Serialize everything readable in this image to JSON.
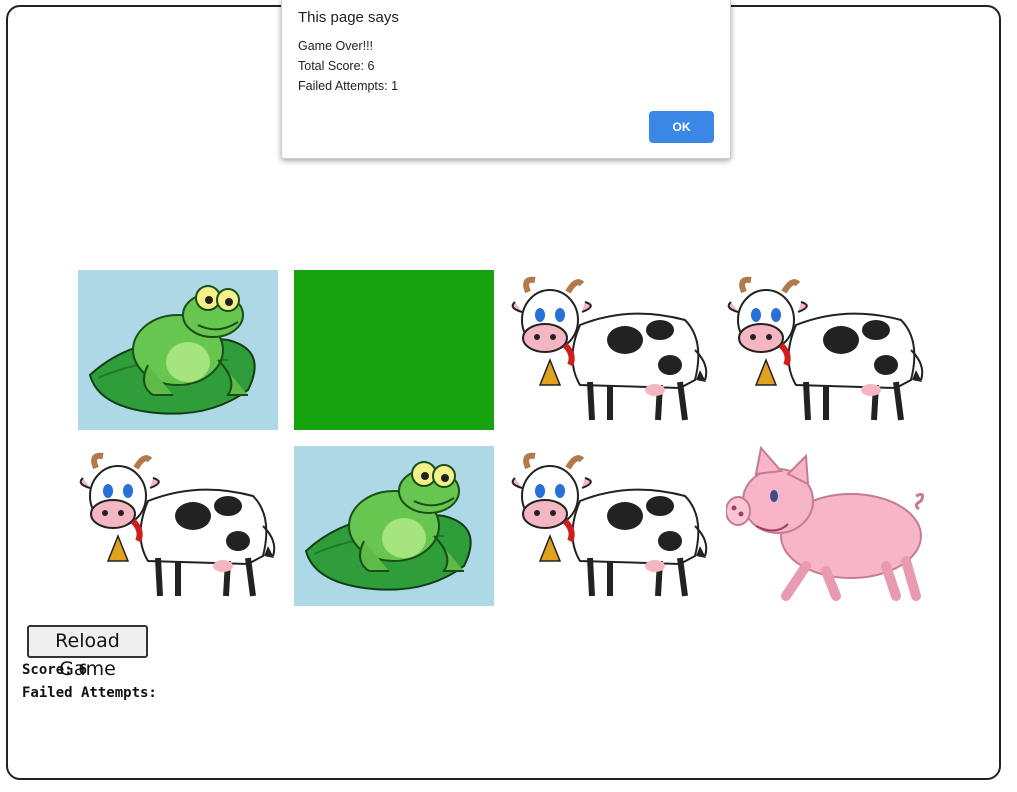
{
  "dialog": {
    "title": "This page says",
    "lines": [
      "Game Over!!!",
      "Total Score: 6",
      "Failed Attempts: 1"
    ],
    "ok_label": "OK",
    "ok_color": "#3b87e8"
  },
  "board": {
    "card_back_color": "#16a10f",
    "frog_bg_color": "#add8e6",
    "cards": [
      {
        "animal": "frog-icon",
        "state": "face-up"
      },
      {
        "animal": "card-back",
        "state": "face-down"
      },
      {
        "animal": "cow-icon",
        "state": "face-up"
      },
      {
        "animal": "cow-icon",
        "state": "face-up"
      },
      {
        "animal": "cow-icon",
        "state": "face-up"
      },
      {
        "animal": "frog-icon",
        "state": "face-up"
      },
      {
        "animal": "cow-icon",
        "state": "face-up"
      },
      {
        "animal": "pig-icon",
        "state": "face-up"
      }
    ]
  },
  "controls": {
    "reload_label": "Reload Game",
    "score_label": "Score:",
    "score_value": "6",
    "failed_label": "Failed Attempts:",
    "failed_value": ""
  }
}
